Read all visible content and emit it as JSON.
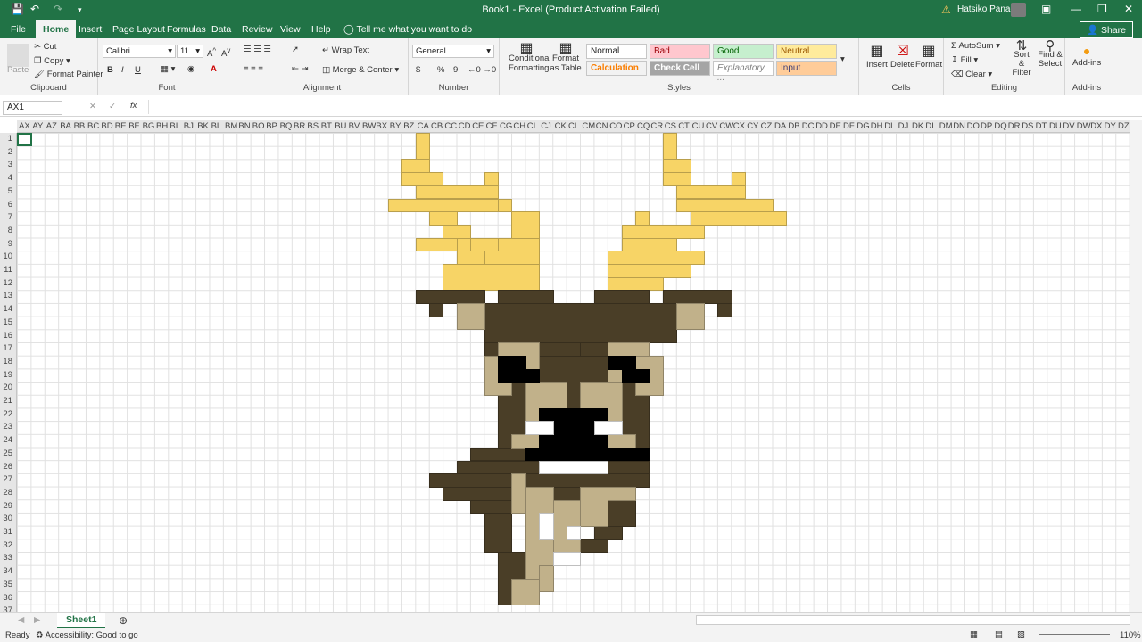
{
  "window": {
    "title": "Book1 - Excel (Product Activation Failed)",
    "user": "Hatsiko Panado"
  },
  "tabs": [
    "File",
    "Home",
    "Insert",
    "Page Layout",
    "Formulas",
    "Data",
    "Review",
    "View",
    "Help"
  ],
  "tell_me": "Tell me what you want to do",
  "share": "Share",
  "ribbon": {
    "clipboard": {
      "label": "Clipboard",
      "paste": "Paste",
      "cut": "Cut",
      "copy": "Copy",
      "format_painter": "Format Painter"
    },
    "font": {
      "label": "Font",
      "name": "Calibri",
      "size": "11",
      "bold": "B",
      "italic": "I",
      "underline": "U"
    },
    "alignment": {
      "label": "Alignment",
      "wrap": "Wrap Text",
      "merge": "Merge & Center"
    },
    "number": {
      "label": "Number",
      "format": "General",
      "currency": "$",
      "percent": "%",
      "comma": "9"
    },
    "styles": {
      "label": "Styles",
      "conditional": "Conditional Formatting",
      "table": "Format as Table",
      "normal": "Normal",
      "bad": "Bad",
      "good": "Good",
      "neutral": "Neutral",
      "calculation": "Calculation",
      "check": "Check Cell",
      "explanatory": "Explanatory ...",
      "input": "Input"
    },
    "cells": {
      "label": "Cells",
      "insert": "Insert",
      "delete": "Delete",
      "format": "Format"
    },
    "editing": {
      "label": "Editing",
      "autosum": "AutoSum",
      "fill": "Fill",
      "clear": "Clear",
      "sort": "Sort & Filter",
      "find": "Find & Select"
    },
    "addins": {
      "label": "Add-ins",
      "name": "Add-ins"
    }
  },
  "formula_bar": {
    "name_box": "AX1",
    "fx": "fx"
  },
  "columns": [
    "AX",
    "AY",
    "AZ",
    "BA",
    "BB",
    "BC",
    "BD",
    "BE",
    "BF",
    "BG",
    "BH",
    "BI",
    "BJ",
    "BK",
    "BL",
    "BM",
    "BN",
    "BO",
    "BP",
    "BQ",
    "BR",
    "BS",
    "BT",
    "BU",
    "BV",
    "BW",
    "BX",
    "BY",
    "BZ",
    "CA",
    "CB",
    "CC",
    "CD",
    "CE",
    "CF",
    "CG",
    "CH",
    "CI",
    "CJ",
    "CK",
    "CL",
    "CM",
    "CN",
    "CO",
    "CP",
    "CQ",
    "CR",
    "CS",
    "CT",
    "CU",
    "CV",
    "CW",
    "CX",
    "CY",
    "CZ",
    "DA",
    "DB",
    "DC",
    "DD",
    "DE",
    "DF",
    "DG",
    "DH",
    "DI",
    "DJ",
    "DK",
    "DL",
    "DM",
    "DN",
    "DO",
    "DP",
    "DQ",
    "DR",
    "DS",
    "DT",
    "DU",
    "DV",
    "DW",
    "DX",
    "DY",
    "DZ"
  ],
  "rows": [
    "1",
    "2",
    "3",
    "4",
    "5",
    "6",
    "7",
    "8",
    "9",
    "10",
    "11",
    "12",
    "13",
    "14",
    "15",
    "16",
    "17",
    "18",
    "19",
    "20",
    "21",
    "22",
    "23",
    "24",
    "25",
    "26",
    "27",
    "28",
    "29",
    "30",
    "31",
    "32",
    "33",
    "34",
    "35",
    "36",
    "37"
  ],
  "sheet": {
    "tab": "Sheet1"
  },
  "status": {
    "ready": "Ready",
    "accessibility": "Accessibility: Good to go",
    "zoom": "110%"
  },
  "colors": {
    "antler": "#f7d466",
    "dark": "#4a3e27",
    "mid": "#6b5839",
    "tan": "#c1b18a",
    "black": "#000000",
    "white": "#ffffff",
    "accent": "#217346"
  },
  "pixel_art": [
    "                             Y      Y                                 ",
    "                             Y      Y                                 ",
    "                            YYY     YY                                ",
    "                           YYYY     YYY                               "
  ]
}
